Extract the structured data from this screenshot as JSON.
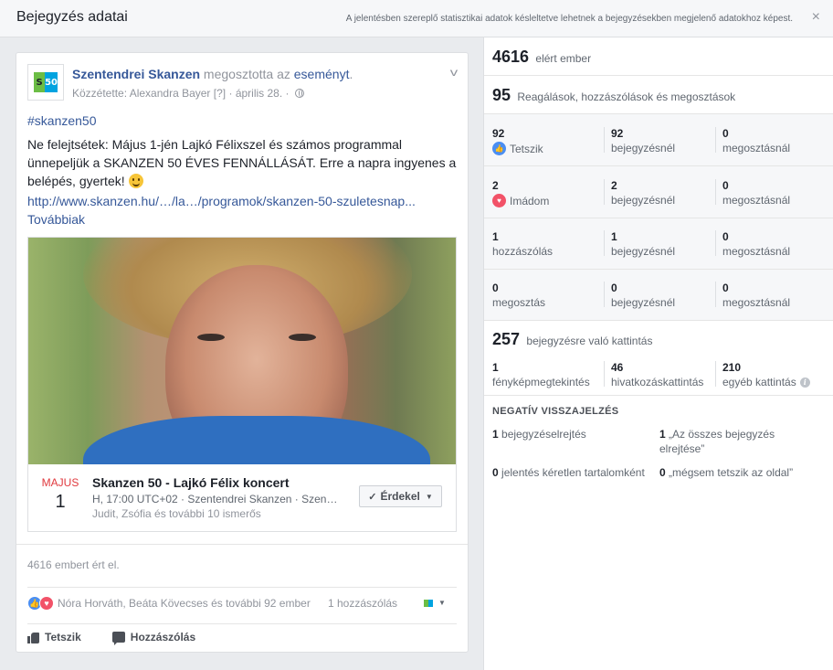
{
  "header": {
    "title": "Bejegyzés adatai",
    "note": "A jelentésben szereplő statisztikai adatok késleltetve lehetnek a bejegyzésekben megjelenő adatokhoz képest.",
    "close_icon": "×"
  },
  "post": {
    "page_name": "Szentendrei Skanzen",
    "shared_text": " megosztotta az ",
    "event_word": "eseményt",
    "period": ".",
    "published_by": "Közzétette: Alexandra Bayer",
    "help_mark": "[?]",
    "dot": "·",
    "date": "április 28.",
    "hashtag": "#skanzen50",
    "text": "Ne felejtsétek: Május 1-jén Lajkó Félixszel és számos programmal ünnepeljük a SKANZEN 50 ÉVES FENNÁLLÁSÁT. Erre a napra ingyenes a belépés, gyertek! ",
    "link": "http://www.skanzen.hu/…/la…/programok/skanzen-50-szuletesnap...",
    "more": "Továbbiak",
    "logo": {
      "left": "S",
      "right": "50"
    }
  },
  "event": {
    "month": "MAJUS",
    "day": "1",
    "title": "Skanzen 50 - Lajkó Félix koncert",
    "details": "H, 17:00 UTC+02 · Szentendrei Skanzen · Szen…",
    "friends": "Judit, Zsófia és további 10 ismerős",
    "button_label": "Érdekel",
    "check": "✓",
    "caret": "▼"
  },
  "footer": {
    "reach_note": "4616 embert ért el.",
    "reactors": "Nóra Horváth, Beáta Kövecses és további 92 ember",
    "comments": "1 hozzászólás",
    "like_label": "Tetszik",
    "comment_label": "Hozzászólás",
    "caret": "▼"
  },
  "stats": {
    "reach": {
      "value": "4616",
      "label": "elért ember"
    },
    "engagement": {
      "value": "95",
      "label": "Reagálások, hozzászólások és megosztások"
    },
    "rows": [
      {
        "total": "92",
        "label": "Tetszik",
        "on_post": "92",
        "on_post_label": "bejegyzésnél",
        "on_share": "0",
        "on_share_label": "megosztásnál"
      },
      {
        "total": "2",
        "label": "Imádom",
        "on_post": "2",
        "on_post_label": "bejegyzésnél",
        "on_share": "0",
        "on_share_label": "megosztásnál"
      },
      {
        "total": "1",
        "label": "hozzászólás",
        "on_post": "1",
        "on_post_label": "bejegyzésnél",
        "on_share": "0",
        "on_share_label": "megosztásnál"
      },
      {
        "total": "0",
        "label": "megosztás",
        "on_post": "0",
        "on_post_label": "bejegyzésnél",
        "on_share": "0",
        "on_share_label": "megosztásnál"
      }
    ],
    "clicks": {
      "value": "257",
      "label": "bejegyzésre való kattintás",
      "items": [
        {
          "value": "1",
          "label": "fényképmegtekintés"
        },
        {
          "value": "46",
          "label": "hivatkozáskattintás"
        },
        {
          "value": "210",
          "label": "egyéb kattintás"
        }
      ],
      "info": "i"
    },
    "negative": {
      "title": "NEGATÍV VISSZAJELZÉS",
      "items": [
        {
          "value": "1",
          "label": "bejegyzéselrejtés"
        },
        {
          "value": "1",
          "label": "„Az összes bejegyzés elrejtése”"
        },
        {
          "value": "0",
          "label": "jelentés kéretlen tartalomként"
        },
        {
          "value": "0",
          "label": "„mégsem tetszik az oldal”"
        }
      ]
    }
  }
}
